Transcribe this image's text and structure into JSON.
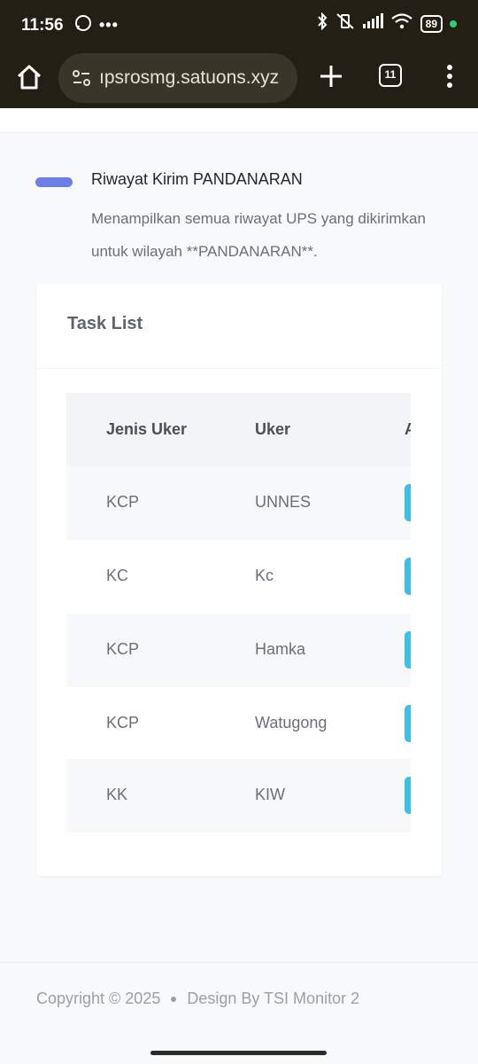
{
  "status_bar": {
    "time": "11:56",
    "battery": "89",
    "icons": [
      "whatsapp-icon",
      "more-dots-icon",
      "bluetooth-icon",
      "vibrate-off-icon",
      "signal-icon",
      "wifi-icon",
      "battery-icon"
    ]
  },
  "browser": {
    "url": "upsrosmg.satuons.xyz",
    "url_visible": "ıpsrosmg.satuons.xyz",
    "tab_count": "11",
    "plus_label": "+"
  },
  "header": {
    "title": "Riwayat Kirim PANDANARAN",
    "description": "Menampilkan semua riwayat UPS yang dikirimkan untuk wilayah **PANDANARAN**."
  },
  "card": {
    "title": "Task List"
  },
  "table": {
    "headers": [
      "Jenis Uker",
      "Uker",
      "A"
    ],
    "rows": [
      {
        "jenis": "KCP",
        "uker": "UNNES"
      },
      {
        "jenis": "KC",
        "uker": "Kc"
      },
      {
        "jenis": "KCP",
        "uker": "Hamka"
      },
      {
        "jenis": "KCP",
        "uker": "Watugong"
      },
      {
        "jenis": "KK",
        "uker": "KIW"
      }
    ]
  },
  "footer": {
    "copyright": "Copyright © 2025",
    "design": "Design By TSI Monitor 2"
  },
  "colors": {
    "accent_pill": "#6c7ee8",
    "action_button": "#3bc0ec",
    "browser_bar": "#241f14"
  }
}
